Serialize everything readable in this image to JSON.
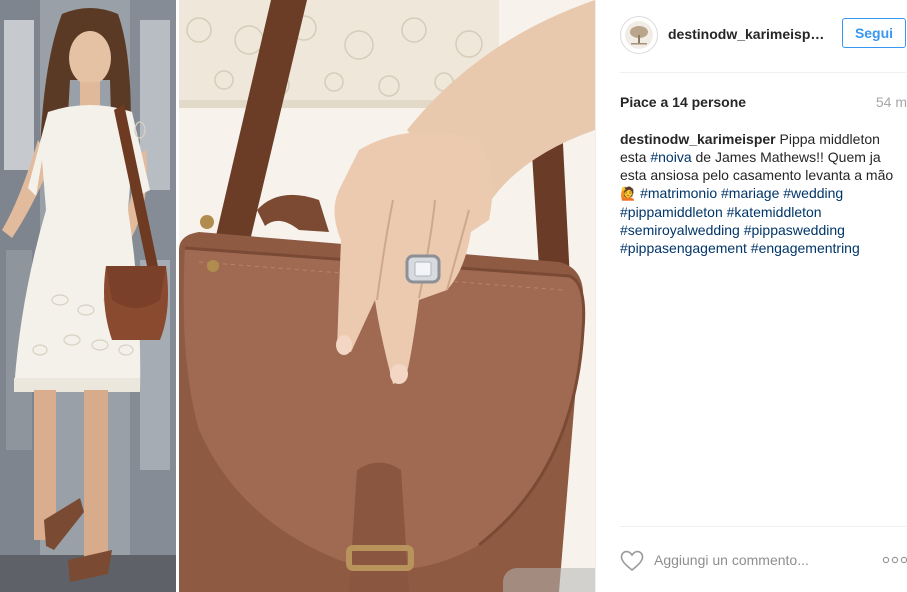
{
  "post": {
    "username": "destinodw_karimeisp…",
    "follow_label": "Segui",
    "likes_text": "Piace a 14 persone",
    "time_ago": "54 m"
  },
  "caption": {
    "username": "destinodw_karimeisper",
    "text1": " Pippa middleton esta ",
    "tag1": "#noiva",
    "text2": " de James Mathews!! Quem ja esta ansiosa pelo casamento levanta a mão ",
    "emoji": "🙋",
    "tags": [
      "#matrimonio",
      "#mariage",
      "#wedding",
      "#pippamiddleton",
      "#katemiddleton",
      "#semiroyalwedding",
      "#pippaswedding",
      "#pippasengagement",
      "#engagementring"
    ]
  },
  "comment": {
    "placeholder": "Aggiungi un commento..."
  },
  "icons": {
    "heart": "heart-icon",
    "more": "more-options-icon",
    "avatar": "avatar-tree-logo"
  },
  "colors": {
    "link_blue": "#3897f0",
    "hashtag": "#003569",
    "muted": "#a5a7aa"
  }
}
